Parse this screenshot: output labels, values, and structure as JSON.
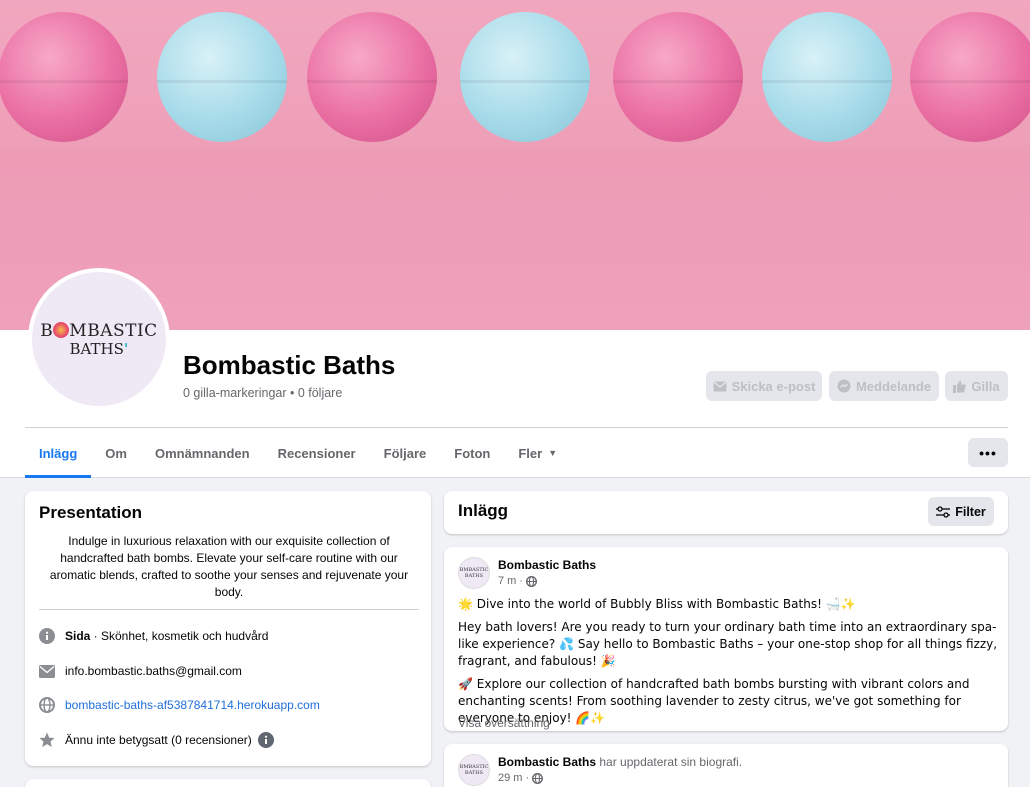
{
  "page": {
    "name": "Bombastic Baths",
    "stats": "0 gilla-markeringar • 0 följare",
    "logo_line1_a": "B",
    "logo_line1_b": "MBASTIC",
    "logo_line2_a": "BATHS",
    "logo_line2_b": "'"
  },
  "actions": {
    "email": "Skicka e-post",
    "message": "Meddelande",
    "like": "Gilla"
  },
  "tabs": [
    {
      "label": "Inlägg",
      "active": true
    },
    {
      "label": "Om"
    },
    {
      "label": "Omnämnanden"
    },
    {
      "label": "Recensioner"
    },
    {
      "label": "Följare"
    },
    {
      "label": "Foton"
    },
    {
      "label": "Fler"
    }
  ],
  "more_label": "•••",
  "intro": {
    "title": "Presentation",
    "bio": "Indulge in luxurious relaxation with our exquisite collection of handcrafted bath bombs. Elevate your self-care routine with our aromatic blends, crafted to soothe your senses and rejuvenate your body.",
    "category_bold": "Sida",
    "category_rest": " · Skönhet, kosmetik och hudvård",
    "email": "info.bombastic.baths@gmail.com",
    "website": "bombastic-baths-af5387841714.herokuapp.com",
    "rating": "Ännu inte betygsatt (0 recensioner)"
  },
  "posts_header": {
    "title": "Inlägg",
    "filter": "Filter"
  },
  "post1": {
    "author": "Bombastic Baths",
    "time": "7 m ·",
    "p1": "🌟 Dive into the world of Bubbly Bliss with Bombastic Baths! 🛁✨",
    "p2": "Hey bath lovers! Are you ready to turn your ordinary bath time into an extraordinary spa-like experience? 💦 Say hello to Bombastic Baths – your one-stop shop for all things fizzy, fragrant, and fabulous! 🎉",
    "p3": "🚀 Explore our collection of handcrafted bath bombs bursting with vibrant colors and enchanting scents! From soothing lavender to zesty citrus, we've got something for everyone to enjoy! 🌈✨",
    "translate": "Visa översättning"
  },
  "post2": {
    "author": "Bombastic Baths",
    "action": " har uppdaterat sin biografi.",
    "time": "29 m ·"
  },
  "colors": {
    "accent": "#1877f2",
    "link": "#216fdb",
    "muted": "#65676b"
  }
}
